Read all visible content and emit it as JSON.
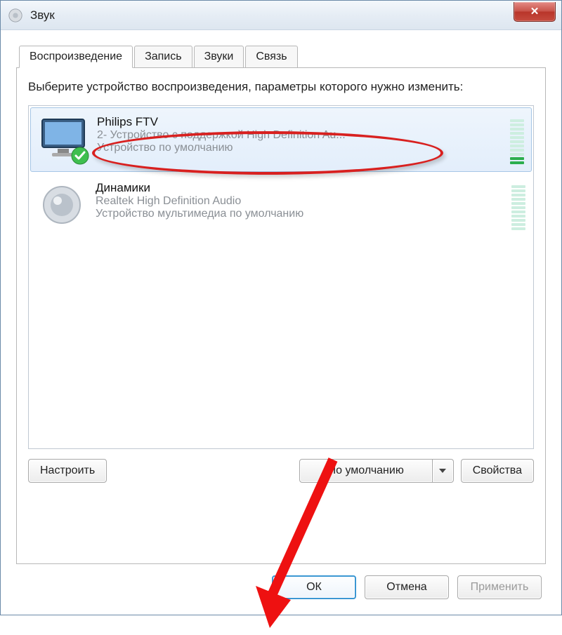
{
  "window": {
    "title": "Звук"
  },
  "tabs": [
    {
      "label": "Воспроизведение",
      "active": true
    },
    {
      "label": "Запись",
      "active": false
    },
    {
      "label": "Звуки",
      "active": false
    },
    {
      "label": "Связь",
      "active": false
    }
  ],
  "instruction": "Выберите устройство воспроизведения, параметры которого нужно изменить:",
  "devices": [
    {
      "name": "Philips FTV",
      "sub1": "2- Устройство с поддержкой High Definition Au...",
      "sub2": "Устройство по умолчанию",
      "selected": true,
      "default_badge": true,
      "icon": "monitor",
      "active_level": 2
    },
    {
      "name": "Динамики",
      "sub1": "Realtek High Definition Audio",
      "sub2": "Устройство мультимедиа по умолчанию",
      "selected": false,
      "default_badge": false,
      "icon": "speaker",
      "active_level": 0
    }
  ],
  "panel_buttons": {
    "configure": "Настроить",
    "set_default": "По умолчанию",
    "properties": "Свойства"
  },
  "dialog_buttons": {
    "ok": "ОК",
    "cancel": "Отмена",
    "apply": "Применить"
  }
}
